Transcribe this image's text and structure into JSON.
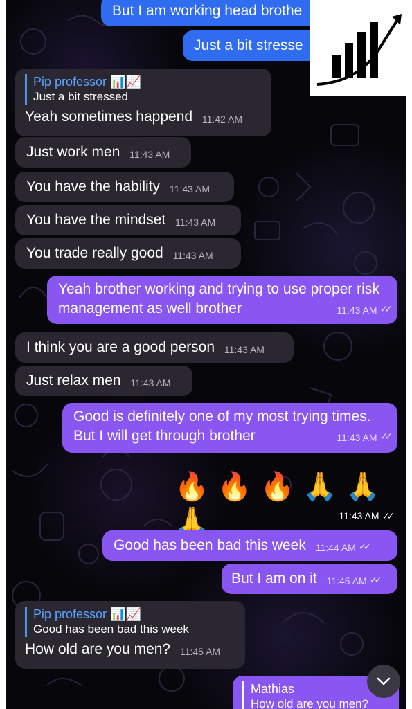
{
  "messages": [
    {
      "id": "m1",
      "text": "But I am working head brothe"
    },
    {
      "id": "m2",
      "text": "Just a bit stresse"
    },
    {
      "id": "m3",
      "reply_name": "Pip professor 📊📈",
      "reply_text": "Just a bit stressed",
      "text": "Yeah sometimes happend",
      "time": "11:42 AM"
    },
    {
      "id": "m4",
      "text": "Just work men",
      "time": "11:43 AM"
    },
    {
      "id": "m5",
      "text": "You have the hability",
      "time": "11:43 AM"
    },
    {
      "id": "m6",
      "text": "You have the mindset",
      "time": "11:43 AM"
    },
    {
      "id": "m7",
      "text": "You trade really good",
      "time": "11:43 AM"
    },
    {
      "id": "m8",
      "text": "Yeah brother working and trying to use proper risk management as well brother",
      "time": "11:43 AM"
    },
    {
      "id": "m9",
      "text": "I think you are a good person",
      "time": "11:43 AM"
    },
    {
      "id": "m10",
      "text": "Just relax men",
      "time": "11:43 AM"
    },
    {
      "id": "m11",
      "text": "Good is definitely one of my most trying times. But I will get through brother",
      "time": "11:43 AM"
    },
    {
      "id": "m12",
      "emojis": "🔥🔥🔥🙏🙏🙏",
      "time": "11:43 AM"
    },
    {
      "id": "m13",
      "text": "Good has been bad this week",
      "time": "11:44 AM"
    },
    {
      "id": "m14",
      "text": "But I am on it",
      "time": "11:45 AM"
    },
    {
      "id": "m15",
      "reply_name": "Pip professor 📊📈",
      "reply_text": "Good has been bad this week",
      "text": "How old are you men?",
      "time": "11:45 AM"
    },
    {
      "id": "m16",
      "reply_name": "Mathias",
      "reply_text": "How old are you men?"
    }
  ],
  "checkmarks": "✓✓",
  "icons": {
    "logo": "growth-chart-logo",
    "scroll_down": "chevron-down-icon"
  },
  "colors": {
    "incoming": "#2a2731",
    "outgoing_blue": "#2f6cf0",
    "outgoing_purple": "#8a56f2",
    "reply_name": "#5aa3ff"
  }
}
